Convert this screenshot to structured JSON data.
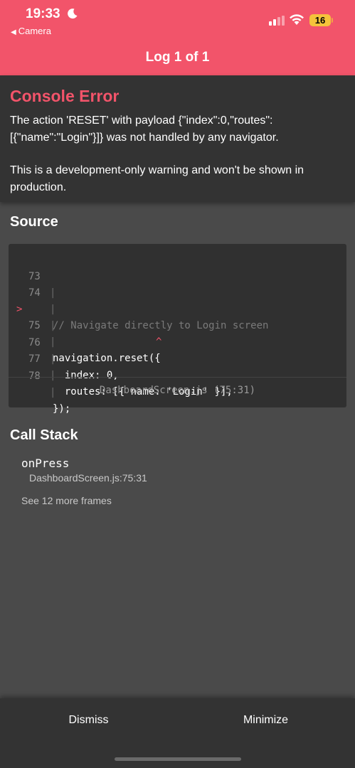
{
  "status_bar": {
    "time": "19:33",
    "back_app": "Camera",
    "battery": "16"
  },
  "header": {
    "title": "Log 1 of 1"
  },
  "error": {
    "title": "Console Error",
    "message": "The action 'RESET' with payload {\"index\":0,\"routes\":[{\"name\":\"Login\"}]} was not handled by any navigator.",
    "warning": "This is a development-only warning and won't be shown in production."
  },
  "source": {
    "title": "Source",
    "lines": [
      {
        "marker": "",
        "number": "73",
        "code": ""
      },
      {
        "marker": "",
        "number": "74",
        "code": "// Navigate directly to Login screen"
      },
      {
        "marker": ">",
        "number": "75",
        "code": "navigation.reset({"
      },
      {
        "marker": "",
        "number": "",
        "code": "^"
      },
      {
        "marker": "",
        "number": "76",
        "code": "  index: 0,"
      },
      {
        "marker": "",
        "number": "77",
        "code": "  routes: [{ name: 'Login' }],"
      },
      {
        "marker": "",
        "number": "78",
        "code": "});"
      }
    ],
    "file": "DashboardScreen.js (75:31)"
  },
  "call_stack": {
    "title": "Call Stack",
    "frames": [
      {
        "name": "onPress",
        "location": "DashboardScreen.js:75:31"
      }
    ],
    "more": "See 12 more frames"
  },
  "footer": {
    "dismiss": "Dismiss",
    "minimize": "Minimize"
  },
  "colors": {
    "accent": "#f2546a",
    "background": "#4a4a4a",
    "panel": "#333333",
    "code_bg": "#303030"
  },
  "icons": [
    "moon-icon",
    "back-triangle-icon",
    "signal-icon",
    "wifi-icon",
    "battery-icon"
  ]
}
